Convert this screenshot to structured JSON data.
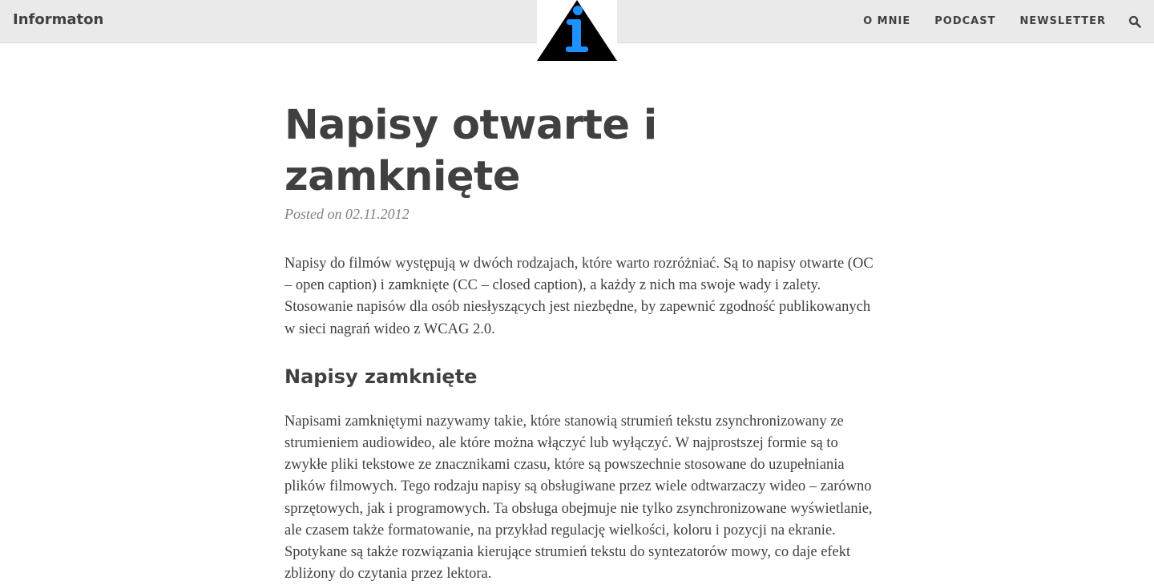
{
  "navbar": {
    "brand": "Informaton",
    "links": [
      {
        "label": "O MNIE"
      },
      {
        "label": "PODCAST"
      },
      {
        "label": "NEWSLETTER"
      }
    ],
    "search_icon": "search-icon",
    "logo": {
      "glyph": "i",
      "triangle_color": "#000000",
      "glyph_color": "#1e90ff"
    }
  },
  "post": {
    "title": "Napisy otwarte i zamknięte",
    "meta": "Posted on 02.11.2012",
    "intro": "Napisy do filmów występują w dwóch rodzajach, które warto rozróżniać. Są to napisy otwarte (OC – open caption) i zamknięte (CC – closed caption), a każdy z nich ma swoje wady i zalety. Stosowanie napisów dla osób niesłyszących jest niezbędne, by zapewnić zgodność publikowanych w sieci nagrań wideo z WCAG 2.0.",
    "section_heading": "Napisy zamknięte",
    "section_text": "Napisami zamkniętymi nazywamy takie, które stanowią strumień tekstu zsynchronizowany ze strumieniem audiowideo, ale które można włączyć lub wyłączyć. W najprostszej formie są to zwykłe pliki tekstowe ze znacznikami czasu, które są powszechnie stosowane do uzupełniania plików filmowych. Tego rodzaju napisy są obsługiwane przez wiele odtwarzaczy wideo – zarówno sprzętowych, jak i programowych. Ta obsługa obejmuje nie tylko zsynchronizowane wyświetlanie, ale czasem także formatowanie, na przykład regulację wielkości, koloru i pozycji na ekranie. Spotykane są także rozwiązania kierujące strumień tekstu do syntezatorów mowy, co daje efekt zbliżony do czytania przez lektora."
  }
}
